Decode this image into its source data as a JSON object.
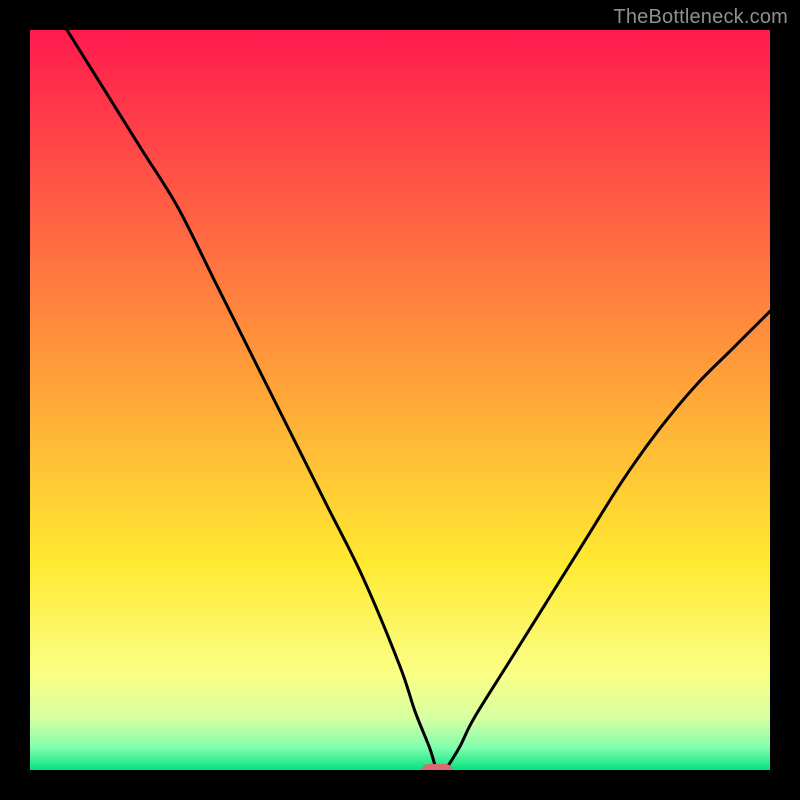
{
  "watermark": "TheBottleneck.com",
  "chart_data": {
    "type": "line",
    "title": "",
    "xlabel": "",
    "ylabel": "",
    "xlim": [
      0,
      100
    ],
    "ylim": [
      0,
      100
    ],
    "x": [
      5,
      10,
      15,
      20,
      25,
      30,
      35,
      40,
      45,
      50,
      52,
      54,
      55,
      56,
      58,
      60,
      65,
      70,
      75,
      80,
      85,
      90,
      95,
      100
    ],
    "values": [
      100,
      92,
      84,
      76,
      66,
      56,
      46,
      36,
      26,
      14,
      8,
      3,
      0,
      0,
      3,
      7,
      15,
      23,
      31,
      39,
      46,
      52,
      57,
      62
    ],
    "marker": {
      "x": 55,
      "y": 0,
      "color": "#d96a6e"
    },
    "background_gradient": {
      "stops": [
        {
          "pct": 0,
          "color": "#ff1a4e"
        },
        {
          "pct": 45,
          "color": "#ff9a3a"
        },
        {
          "pct": 72,
          "color": "#ffe931"
        },
        {
          "pct": 87,
          "color": "#fbff86"
        },
        {
          "pct": 93,
          "color": "#d7ffa0"
        },
        {
          "pct": 97,
          "color": "#7fffb0"
        },
        {
          "pct": 100,
          "color": "#05e27e"
        }
      ]
    }
  }
}
